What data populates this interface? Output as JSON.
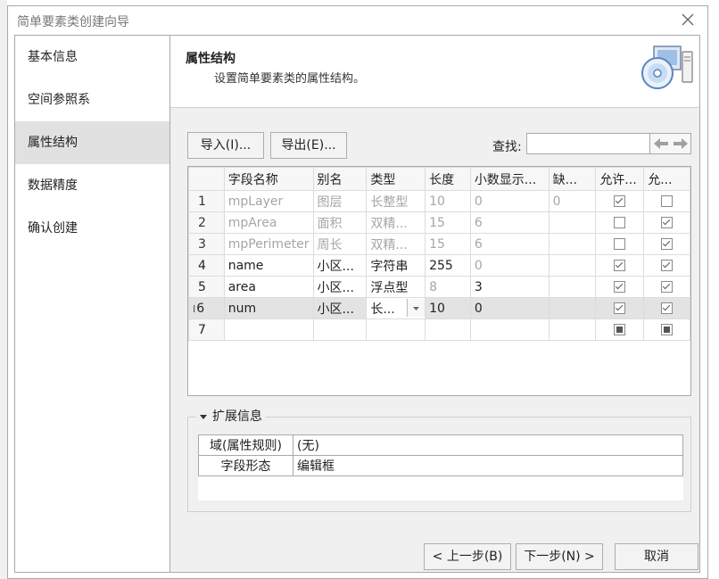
{
  "dialog": {
    "title": "简单要素类创建向导"
  },
  "steps": [
    {
      "label": "基本信息",
      "active": false
    },
    {
      "label": "空间参照系",
      "active": false
    },
    {
      "label": "属性结构",
      "active": true
    },
    {
      "label": "数据精度",
      "active": false
    },
    {
      "label": "确认创建",
      "active": false
    }
  ],
  "header": {
    "title": "属性结构",
    "subtitle": "设置简单要素类的属性结构。"
  },
  "toolbar": {
    "import_label": "导入(I)...",
    "export_label": "导出(E)...",
    "find_label": "查找:",
    "find_value": ""
  },
  "grid": {
    "columns": [
      "字段名称",
      "别名",
      "类型",
      "长度",
      "小数显示...",
      "缺...",
      "允许...",
      "允..."
    ],
    "rows": [
      {
        "num": "1",
        "name": "mpLayer",
        "alias": "图层",
        "type": "长整型",
        "length": "10",
        "decimal": "0",
        "default": "0",
        "allow_null": true,
        "allow2": false,
        "style": "dim"
      },
      {
        "num": "2",
        "name": "mpArea",
        "alias": "面积",
        "type": "双精...",
        "length": "15",
        "decimal": "6",
        "default": "",
        "allow_null": false,
        "allow2": true,
        "style": "dim"
      },
      {
        "num": "3",
        "name": "mpPerimeter",
        "alias": "周长",
        "type": "双精...",
        "length": "15",
        "decimal": "6",
        "default": "",
        "allow_null": false,
        "allow2": true,
        "style": "dim"
      },
      {
        "num": "4",
        "name": "name",
        "alias": "小区...",
        "type": "字符串",
        "length": "255",
        "decimal": "0",
        "default": "",
        "allow_null": true,
        "allow2": true,
        "style": "normal"
      },
      {
        "num": "5",
        "name": "area",
        "alias": "小区...",
        "type": "浮点型",
        "length": "8",
        "decimal": "3",
        "default": "",
        "allow_null": true,
        "allow2": true,
        "style": "normal"
      },
      {
        "num": "6",
        "name": "num",
        "alias": "小区...",
        "type": "长...",
        "length": "10",
        "decimal": "0",
        "default": "",
        "allow_null": true,
        "allow2": true,
        "style": "selected"
      },
      {
        "num": "7",
        "name": "",
        "alias": "",
        "type": "",
        "length": "",
        "decimal": "",
        "default": "",
        "allow_null": "indeterminate",
        "allow2": "indeterminate",
        "style": "new"
      }
    ]
  },
  "extended": {
    "title": "扩展信息",
    "props": [
      {
        "key": "域(属性规则)",
        "value": "(无)"
      },
      {
        "key": "字段形态",
        "value": "编辑框"
      }
    ]
  },
  "footer": {
    "prev_label": "< 上一步(B)",
    "next_label": "下一步(N) >",
    "cancel_label": "取消"
  }
}
